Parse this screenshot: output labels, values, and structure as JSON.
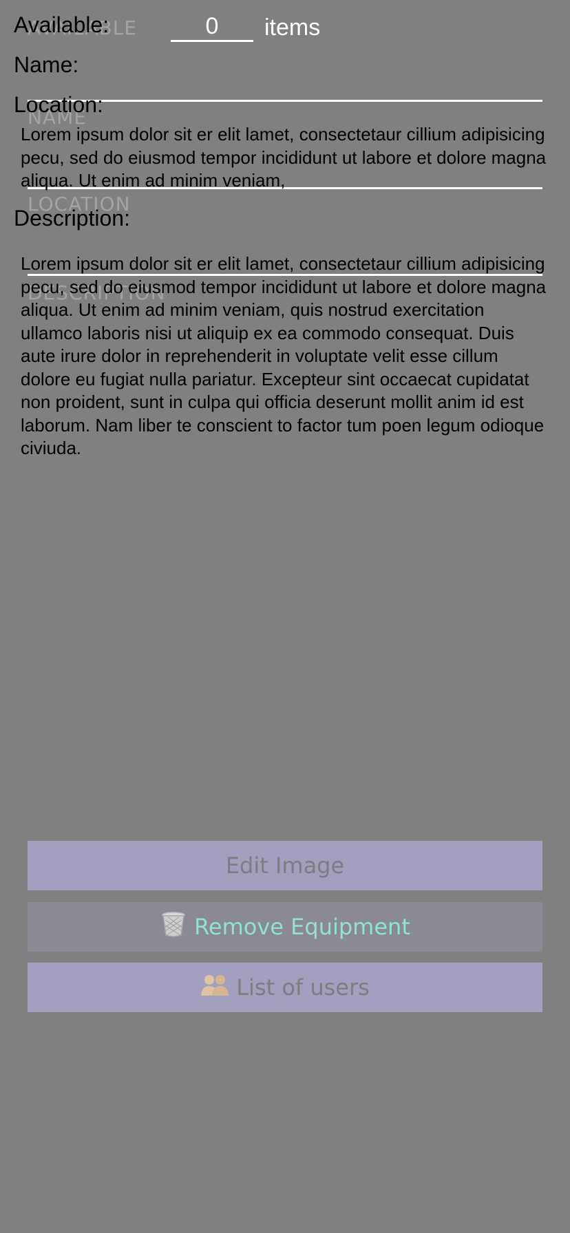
{
  "fields": {
    "available_label": "Available:",
    "available_value": "0",
    "items_unit": "items",
    "name_label": "Name:",
    "location_label": "Location:",
    "description_label": "Description:",
    "location_text": "Lorem ipsum dolor sit er elit lamet, consectetaur cillium adipisicing pecu, sed do eiusmod tempor incididunt ut labore et dolore magna aliqua. Ut enim ad minim veniam,",
    "description_text": "Lorem ipsum dolor sit er elit lamet, consectetaur cillium adipisicing pecu, sed do eiusmod tempor incididunt ut labore et dolore magna aliqua. Ut enim ad minim veniam, quis nostrud exercitation ullamco laboris nisi ut aliquip ex ea commodo consequat. Duis aute irure dolor in reprehenderit in voluptate velit esse cillum dolore eu fugiat nulla pariatur. Excepteur sint occaecat cupidatat non proident, sunt in culpa qui officia deserunt mollit anim id est laborum. Nam liber te conscient to factor tum poen legum odioque civiuda."
  },
  "placeholders": {
    "available": "AVAILABLE",
    "name": "NAME",
    "location": "LOCATION",
    "description": "DESCRIPTION"
  },
  "buttons": {
    "edit_image": "Edit Image",
    "remove_equipment": "Remove Equipment",
    "list_of_users": "List of users"
  },
  "icons": {
    "remove": "trash-icon",
    "users": "users-icon"
  },
  "colors": {
    "background": "#808080",
    "button_primary": "#a29fbf",
    "button_remove": "#8b8a94",
    "remove_text": "#8fe3d0"
  }
}
